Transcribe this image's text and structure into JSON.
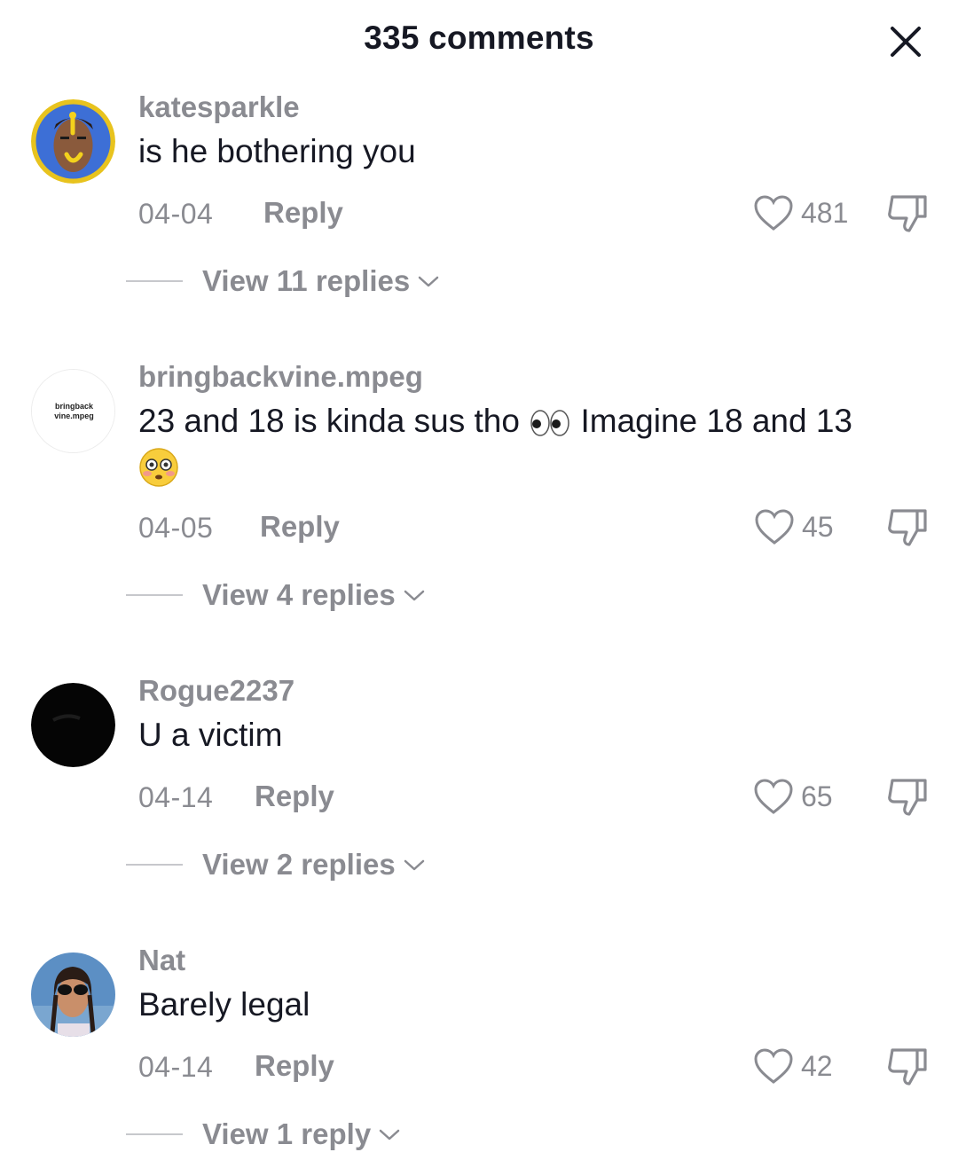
{
  "header": {
    "title": "335 comments",
    "close_icon": "close-icon"
  },
  "comments": [
    {
      "username": "katesparkle",
      "text": "is he bothering you",
      "date": "04-04",
      "reply_label": "Reply",
      "likes": "481",
      "view_replies": "View 11 replies",
      "avatar_colors": {
        "ring": "#e8c31e",
        "bg": "#3d6fd6"
      }
    },
    {
      "username": "bringbackvine.mpeg",
      "text_part1": "23 and 18 is kinda sus tho",
      "text_part2": "Imagine 18 and 13",
      "date": "04-05",
      "reply_label": "Reply",
      "likes": "45",
      "view_replies": "View 4 replies",
      "avatar_text_line1": "bringback",
      "avatar_text_line2": "vine.mpeg"
    },
    {
      "username": "Rogue2237",
      "text": "U a victim",
      "date": "04-14",
      "reply_label": "Reply",
      "likes": "65",
      "view_replies": "View 2 replies"
    },
    {
      "username": "Nat",
      "text": "Barely legal",
      "date": "04-14",
      "reply_label": "Reply",
      "likes": "42",
      "view_replies": "View 1 reply"
    }
  ],
  "colors": {
    "primary_text": "#161823",
    "secondary_text": "#8a8b91"
  }
}
